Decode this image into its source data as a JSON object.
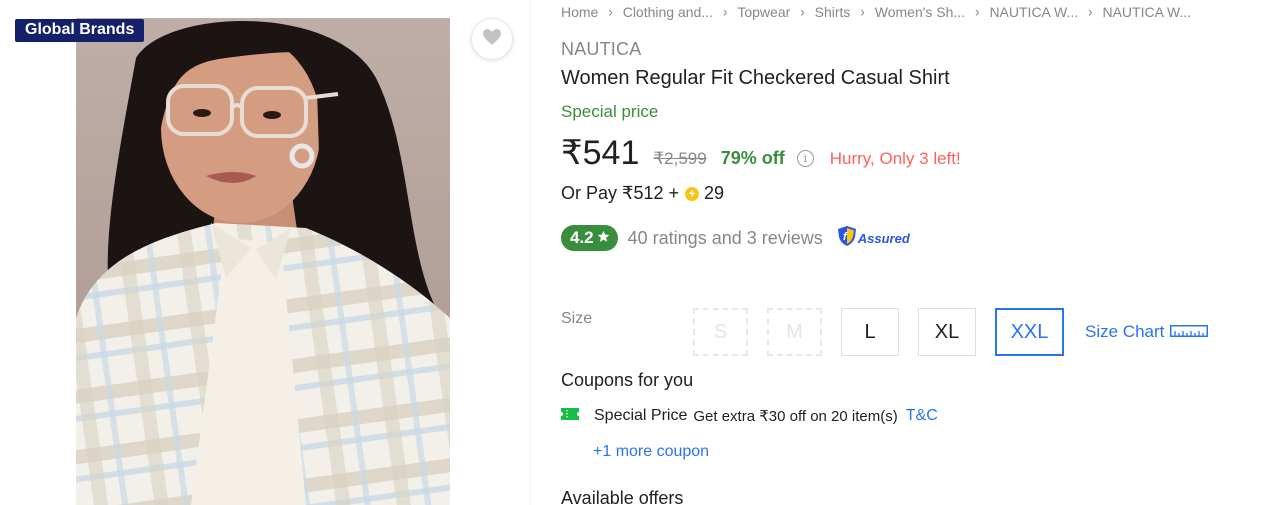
{
  "gallery": {
    "badge": "Global Brands",
    "wishlist_icon": "heart-icon"
  },
  "breadcrumb": [
    "Home",
    "Clothing and...",
    "Topwear",
    "Shirts",
    "Women's Sh...",
    "NAUTICA W...",
    "NAUTICA W..."
  ],
  "product": {
    "brand": "NAUTICA",
    "title": "Women Regular Fit Checkered Casual Shirt",
    "special_price_label": "Special price",
    "price": "₹541",
    "mrp": "₹2,599",
    "discount": "79% off",
    "stock_warning": "Hurry, Only 3 left!",
    "or_pay_prefix": "Or Pay ₹512 +",
    "or_pay_coins": "29",
    "rating": "4.2",
    "ratings_text": "40 ratings and 3 reviews",
    "assured_label": "Assured"
  },
  "size": {
    "label": "Size",
    "options": [
      {
        "label": "S",
        "state": "disabled"
      },
      {
        "label": "M",
        "state": "disabled"
      },
      {
        "label": "L",
        "state": "available"
      },
      {
        "label": "XL",
        "state": "available"
      },
      {
        "label": "XXL",
        "state": "selected"
      }
    ],
    "chart_label": "Size Chart"
  },
  "coupons": {
    "heading": "Coupons for you",
    "items": [
      {
        "name": "Special Price",
        "desc": "Get extra ₹30 off on 20 item(s)",
        "tnc": "T&C"
      }
    ],
    "more": "+1 more coupon"
  },
  "offers": {
    "heading": "Available offers"
  },
  "colors": {
    "accent": "#2874f0",
    "green": "#388e3c",
    "badge_bg": "#15206b",
    "warning": "#ff6161"
  }
}
